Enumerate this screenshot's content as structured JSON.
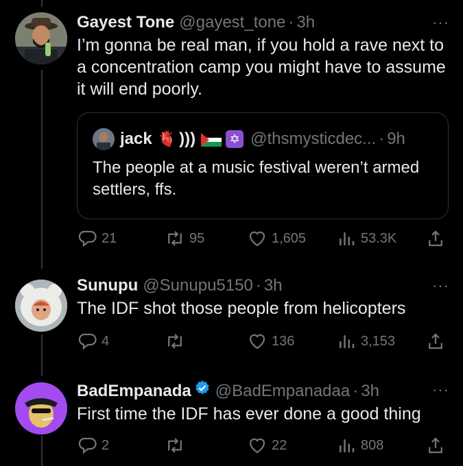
{
  "tweets": [
    {
      "name": "Gayest Tone",
      "handle": "@gayest_tone",
      "time": "3h",
      "dot": "·",
      "more": "···",
      "text": "I’m gonna be real man, if you hold a rave next to a concentration camp you might have to assume it will end poorly.",
      "quote": {
        "name": "jack",
        "emoji_heart": "🫀",
        "sound": ")))",
        "handle": "@thsmysticdec...",
        "time": "9h",
        "dot": "·",
        "text": "The people at a music festival weren’t armed settlers, ffs."
      },
      "replies": "21",
      "retweets": "95",
      "likes": "1,605",
      "views": "53.3K"
    },
    {
      "name": "Sunupu",
      "handle": "@Sunupu5150",
      "time": "3h",
      "dot": "·",
      "more": "···",
      "text": "The IDF shot those people from helicopters",
      "replies": "4",
      "retweets": "",
      "likes": "136",
      "views": "3,153"
    },
    {
      "name": "BadEmpanada",
      "handle": "@BadEmpanadaa",
      "time": "3h",
      "dot": "·",
      "more": "···",
      "text": "First time the IDF has ever done a good thing",
      "replies": "2",
      "retweets": "",
      "likes": "22",
      "views": "808"
    }
  ],
  "icons": {
    "reply": "reply-icon",
    "retweet": "retweet-icon",
    "like": "like-icon",
    "views": "views-icon",
    "share": "share-icon"
  },
  "colors": {
    "background": "#000000",
    "text": "#e7e9ea",
    "muted": "#71767b",
    "verified": "#1d9bf0"
  }
}
